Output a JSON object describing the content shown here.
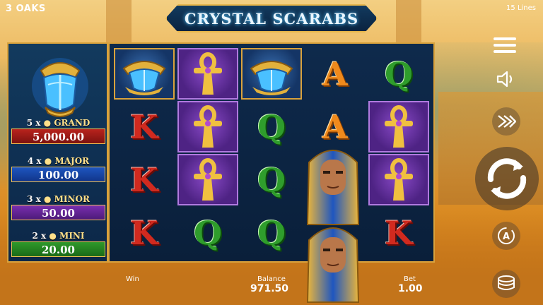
{
  "header": {
    "brand": "3 OAKS",
    "title": "CRYSTAL SCARABS",
    "lines": "15 Lines"
  },
  "jackpots": [
    {
      "mult": "5 x",
      "name": "GRAND",
      "value": "5,000.00"
    },
    {
      "mult": "4 x",
      "name": "MAJOR",
      "value": "100.00"
    },
    {
      "mult": "3 x",
      "name": "MINOR",
      "value": "50.00"
    },
    {
      "mult": "2 x",
      "name": "MINI",
      "value": "20.00"
    }
  ],
  "reels": [
    [
      "scarab",
      "ankh",
      "scarab",
      "A",
      "Q"
    ],
    [
      "K",
      "ankh",
      "Q",
      "A",
      "ankh"
    ],
    [
      "K",
      "ankh",
      "Q",
      "pharaoh",
      "ankh"
    ],
    [
      "K",
      "Q",
      "Q",
      "pharaoh",
      "K"
    ]
  ],
  "status": {
    "win_label": "Win",
    "balance_label": "Balance",
    "balance_value": "971.50",
    "bet_label": "Bet",
    "bet_value": "1.00"
  },
  "controls": {
    "menu_icon": "menu-icon",
    "sound_icon": "speaker-icon",
    "turbo_icon": "fast-forward-icon",
    "spin_icon": "spin-icon",
    "autoplay_icon": "autoplay-icon",
    "bet_icon": "coins-icon"
  },
  "colors": {
    "frame_gold": "#d9a23c",
    "reel_bg": "#0e2a4c",
    "letter_red": "#d12a1f",
    "letter_green": "#2f9d2c",
    "letter_orange": "#f08a1c"
  }
}
